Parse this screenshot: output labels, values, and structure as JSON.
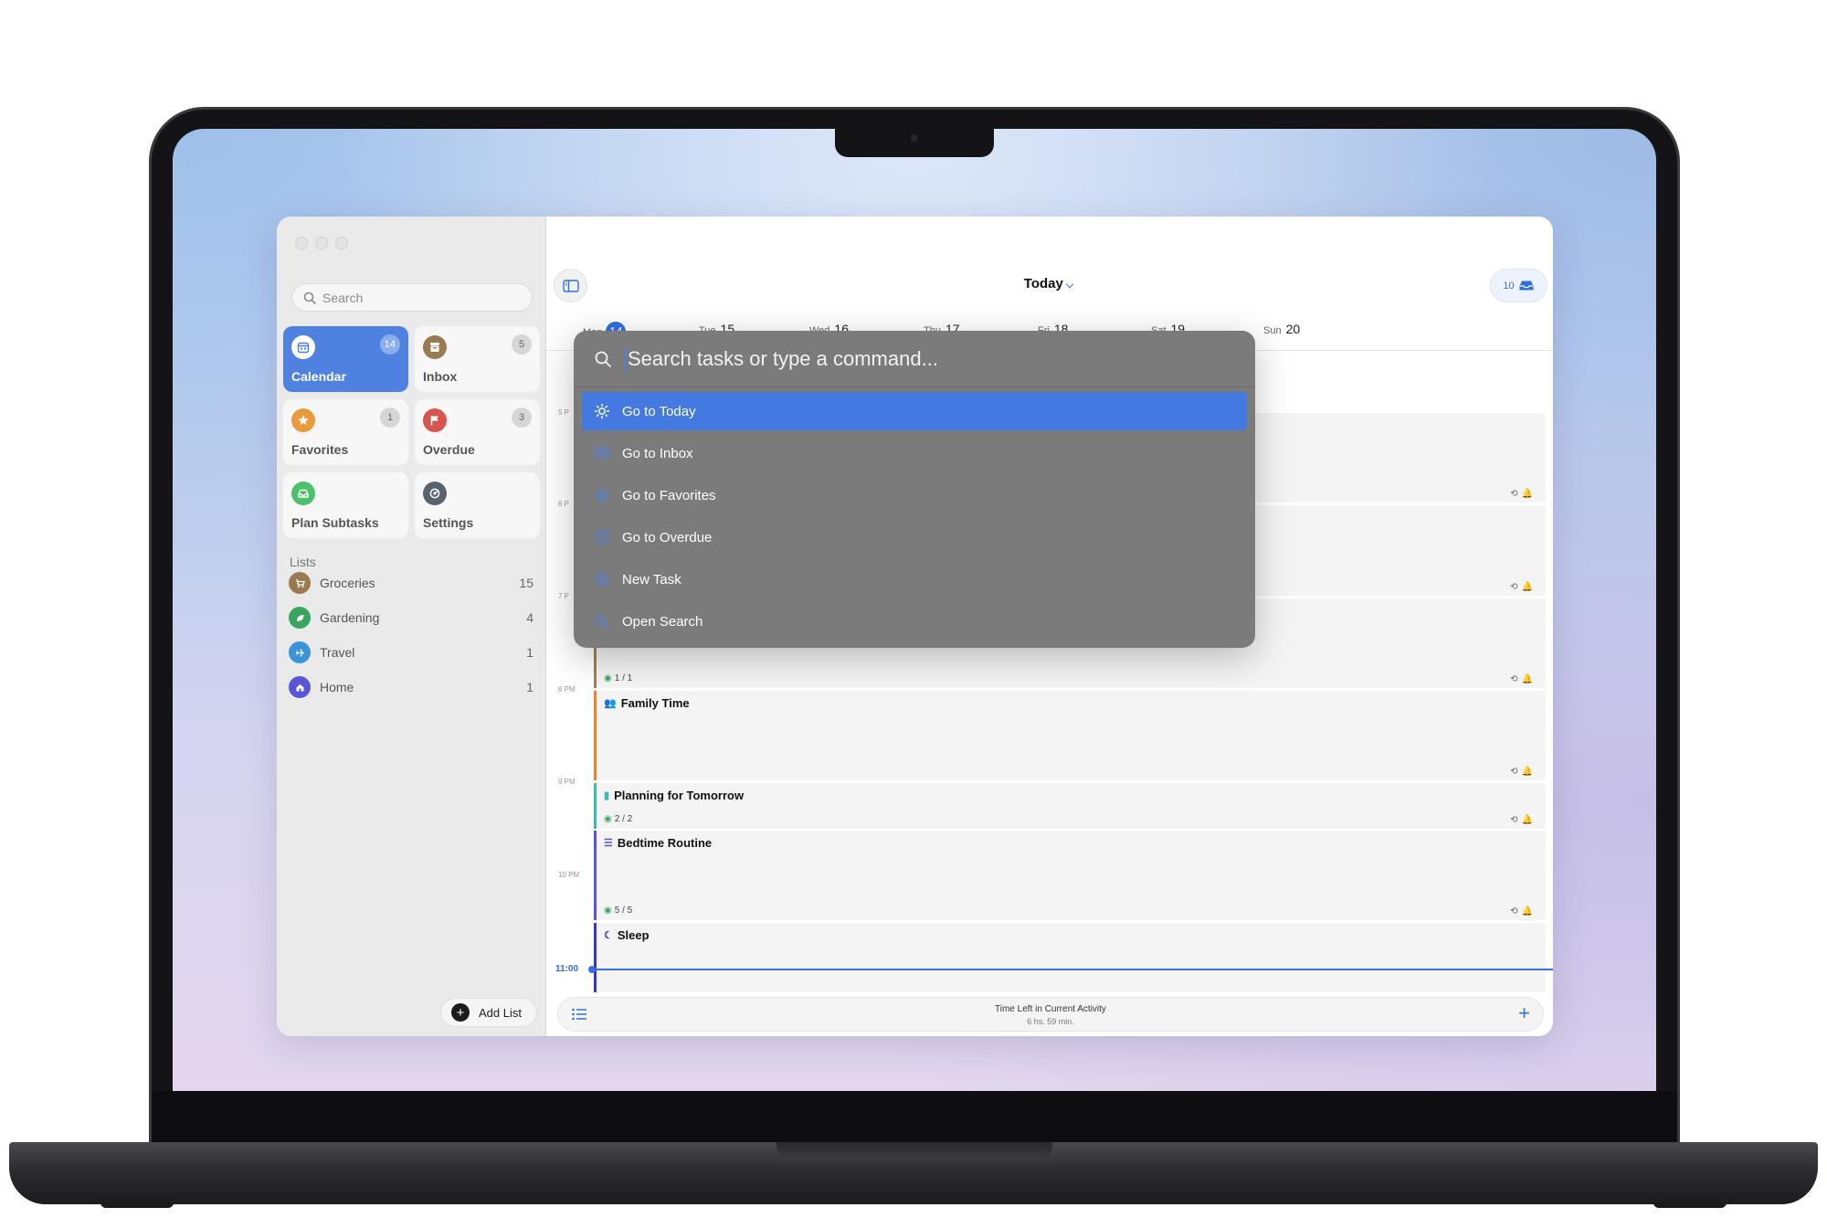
{
  "sidebar": {
    "search_placeholder": "Search",
    "tiles": [
      {
        "label": "Calendar",
        "count": "14",
        "icon": "calendar-icon",
        "color": "#4f82e0"
      },
      {
        "label": "Inbox",
        "count": "5",
        "icon": "inbox-icon",
        "color": "#9a7b4f"
      },
      {
        "label": "Favorites",
        "count": "1",
        "icon": "star-icon",
        "color": "#ea9a3a"
      },
      {
        "label": "Overdue",
        "count": "3",
        "icon": "flag-icon",
        "color": "#d9534f"
      },
      {
        "label": "Plan Subtasks",
        "icon": "tray-icon",
        "color": "#4cc26a"
      },
      {
        "label": "Settings",
        "icon": "gear-icon",
        "color": "#5a6270"
      }
    ],
    "lists_title": "Lists",
    "lists": [
      {
        "name": "Groceries",
        "count": "15",
        "icon": "cart-icon",
        "color": "#9a7b4f"
      },
      {
        "name": "Gardening",
        "count": "4",
        "icon": "leaf-icon",
        "color": "#3aa55e"
      },
      {
        "name": "Travel",
        "count": "1",
        "icon": "airplane-icon",
        "color": "#3a94d9"
      },
      {
        "name": "Home",
        "count": "1",
        "icon": "house-icon",
        "color": "#5856d6"
      }
    ],
    "add_list_label": "Add List"
  },
  "header": {
    "title": "Today",
    "inbox_count": "10"
  },
  "week": [
    {
      "dow": "Mon",
      "date": "14",
      "current": true
    },
    {
      "dow": "Tue",
      "date": "15"
    },
    {
      "dow": "Wed",
      "date": "16"
    },
    {
      "dow": "Thu",
      "date": "17"
    },
    {
      "dow": "Fri",
      "date": "18"
    },
    {
      "dow": "Sat",
      "date": "19"
    },
    {
      "dow": "Sun",
      "date": "20"
    }
  ],
  "hours": [
    "5 P",
    "6 P",
    "7 P",
    "8 PM",
    "9 PM",
    "10 PM"
  ],
  "now_label": "11:00",
  "events": [
    {
      "title": "",
      "sub": ""
    },
    {
      "title": "",
      "sub": ""
    },
    {
      "title": "",
      "sub": "1 / 1"
    },
    {
      "title": "Family Time",
      "sub": "",
      "icon": "people-icon",
      "color": "#e8862f"
    },
    {
      "title": "Planning for Tomorrow",
      "sub": "2 / 2",
      "icon": "clipboard-icon",
      "color": "#3fb8a8"
    },
    {
      "title": "Bedtime Routine",
      "sub": "5 / 5",
      "icon": "checklist-icon",
      "color": "#5856d6"
    },
    {
      "title": "Sleep",
      "sub": "",
      "icon": "moon-icon",
      "color": "#3a3ab8"
    }
  ],
  "bottom_bar": {
    "line1": "Time Left in Current Activity",
    "line2": "6 hs. 59 min."
  },
  "palette": {
    "placeholder": "Search tasks or type a command...",
    "commands": [
      {
        "label": "Go to Today",
        "icon": "sun-icon",
        "selected": true
      },
      {
        "label": "Go to Inbox",
        "icon": "envelope-icon"
      },
      {
        "label": "Go to Favorites",
        "icon": "star-icon"
      },
      {
        "label": "Go to Overdue",
        "icon": "clock-icon"
      },
      {
        "label": "New Task",
        "icon": "plus-circle-icon"
      },
      {
        "label": "Open Search",
        "icon": "search-icon"
      }
    ]
  }
}
